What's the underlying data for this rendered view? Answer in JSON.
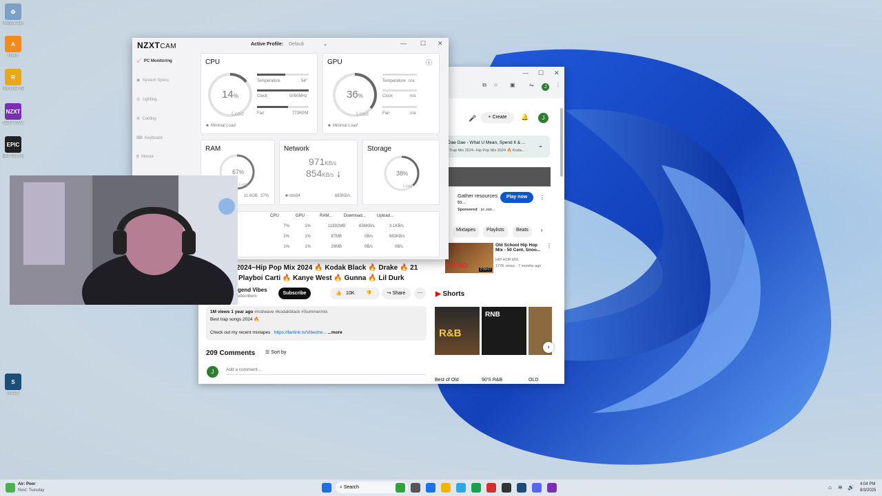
{
  "desktop": {
    "icons": [
      {
        "label": "Recycle Bin",
        "color": "#7aa0c8",
        "glyph": "♻"
      },
      {
        "label": "Fiverr",
        "color": "#f28b1c",
        "glyph": "A"
      },
      {
        "label": "Rockstar Games Launcher",
        "color": "#e7a81b",
        "glyph": "R"
      },
      {
        "label": "NZXT CAM",
        "color": "#7a2fb5",
        "glyph": "NZXT"
      },
      {
        "label": "Epic Games Launcher",
        "color": "#222",
        "glyph": "EPIC"
      },
      {
        "label": "Steam",
        "color": "#1b4f7a",
        "glyph": "S"
      }
    ]
  },
  "nzxt": {
    "brand": "NZXT",
    "brand_sub": "CAM",
    "active_profile_label": "Active Profile:",
    "active_profile_value": "Default",
    "sidebar": [
      {
        "label": "PC Monitoring",
        "active": true
      },
      {
        "label": "System Specs"
      },
      {
        "label": "Lighting"
      },
      {
        "label": "Cooling"
      },
      {
        "label": "Keyboard"
      },
      {
        "label": "Mouse"
      }
    ],
    "cpu": {
      "title": "CPU",
      "load": "14",
      "unit": "%",
      "load_label": "Load",
      "fraction": 0.14,
      "temp_label": "Temperature",
      "temp": "54°",
      "clock_label": "Clock",
      "clock": "5050MHz",
      "fan_label": "Fan",
      "fan": "773RPM",
      "mode": "Minimal Load"
    },
    "gpu": {
      "title": "GPU",
      "load": "36",
      "unit": "%",
      "load_label": "Load",
      "fraction": 0.36,
      "temp_label": "Temperature",
      "temp": "n/a",
      "clock_label": "Clock",
      "clock": "n/a",
      "fan_label": "Fan",
      "fan": "n/a",
      "mode": "Minimal Load"
    },
    "ram": {
      "title": "RAM",
      "load": "67",
      "unit": "%",
      "load_label": "Load",
      "fraction": 0.67,
      "used": "11.6GB",
      "pct": "37%"
    },
    "network": {
      "title": "Network",
      "down": "971",
      "down_unit": "KB/s",
      "up": "854",
      "up_unit": "KB/s",
      "process": "obs64",
      "process_val": "683KB/s"
    },
    "storage": {
      "title": "Storage",
      "load": "38",
      "unit": "%",
      "load_label": "Load",
      "fraction": 0.38
    },
    "table": {
      "headers": [
        "CPU",
        "GPU",
        "RAM...",
        "Download...",
        "Upload..."
      ],
      "rows": [
        [
          "7%",
          "1%",
          "11892MB",
          "636KB/s",
          "3.1KB/s"
        ],
        [
          "2%",
          "1%",
          "87MB",
          "0B/s",
          "683KB/s"
        ],
        [
          "1%",
          "1%",
          "29MB",
          "0B/s",
          "0B/s"
        ]
      ]
    }
  },
  "youtube": {
    "create_label": "Create",
    "avatar": "J",
    "playlist_title": "Dae Dae - What U Mean, Spend It & ...",
    "playlist_sub": "Trap Mix 2024--Hip Pop Mix 2024 🔥 Koda...",
    "ad_title": "Gather resources to...",
    "ad_sponsored": "Sponsored",
    "ad_domain": "pc.stat...",
    "ad_button": "Play now",
    "chips": [
      "Mixtapes",
      "Playlists",
      "Beats"
    ],
    "rec": {
      "title": "Old School Hip Hop Mix - 50 Cent, Snoo...",
      "channel": "HIP HOP MIX",
      "meta": "177K views · 7 months ago",
      "duration": "2:09:07"
    },
    "video_title_1": "2024~Hip Pop Mix 2024 🔥 Kodak Black 🔥 Drake 🔥 21",
    "video_title_2": "Playboi Carti 🔥 Kanye West 🔥 Gunna 🔥 Lil Durk",
    "channel": "gend Vibes",
    "subscribers": "ubscribers",
    "subscribe": "Subscribe",
    "likes": "10K",
    "share": "Share",
    "desc_meta": "1M views  1 year ago",
    "desc_tags": "#rodwave #kodakblack #Summermix",
    "desc_line": "Best trap songs 2024 🔥",
    "desc_link_text": "Check out my recent mixtapes",
    "desc_link": "https://fanlink.tv/Vibeche...",
    "more": "...more",
    "comments": "209 Comments",
    "sort": "Sort by",
    "add_comment": "Add a comment...",
    "shorts_title": "Shorts",
    "shorts": [
      {
        "label": "Best of Old"
      },
      {
        "label": "90'S R&B"
      },
      {
        "label": "OLD"
      }
    ]
  },
  "taskbar": {
    "weather_title": "Air: Poor",
    "weather_sub": "Next: Tuesday",
    "search": "Search",
    "time": "4:04 PM",
    "date": "8/3/2025"
  }
}
